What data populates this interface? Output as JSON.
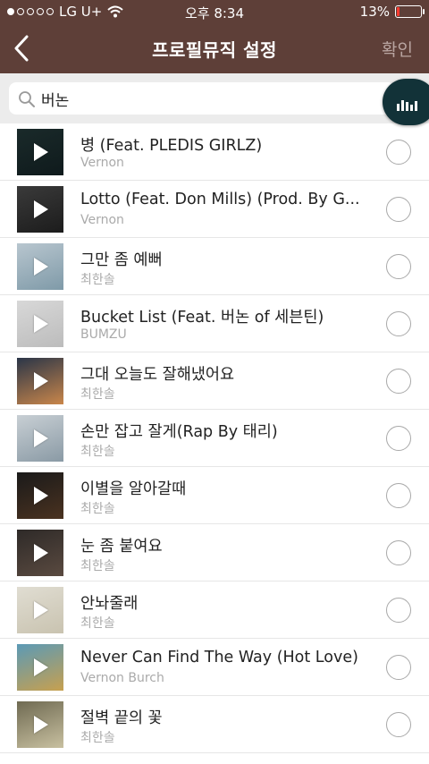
{
  "status_bar": {
    "carrier": "LG U+",
    "time": "오후 8:34",
    "battery": "13%",
    "signal_bars": 1,
    "battery_level": 0.13,
    "battery_color": "#ff3b30"
  },
  "header": {
    "title": "프로필뮤직 설정",
    "confirm_label": "확인",
    "back_icon": "chevron-left-icon",
    "bg_color": "#5e3f38"
  },
  "search": {
    "value": "버논",
    "icon": "search-icon"
  },
  "player_button": {
    "icon": "equalizer-icon"
  },
  "songs": [
    {
      "title": "병 (Feat. PLEDIS GIRLZ)",
      "artist": "Vernon"
    },
    {
      "title": "Lotto (Feat. Don Mills) (Prod. By G...",
      "artist": "Vernon"
    },
    {
      "title": "그만 좀 예뻐",
      "artist": "최한솔"
    },
    {
      "title": "Bucket List (Feat. 버논 of 세븐틴)",
      "artist": "BUMZU"
    },
    {
      "title": "그대 오늘도 잘해냈어요",
      "artist": "최한솔"
    },
    {
      "title": "손만 잡고 잘게(Rap By 태리)",
      "artist": "최한솔"
    },
    {
      "title": "이별을 알아갈때",
      "artist": "최한솔"
    },
    {
      "title": "눈 좀 붙여요",
      "artist": "최한솔"
    },
    {
      "title": "안놔줄래",
      "artist": "최한솔"
    },
    {
      "title": "Never Can Find The Way (Hot Love)",
      "artist": "Vernon Burch"
    },
    {
      "title": "절벽 끝의 꽃",
      "artist": "최한솔"
    }
  ]
}
